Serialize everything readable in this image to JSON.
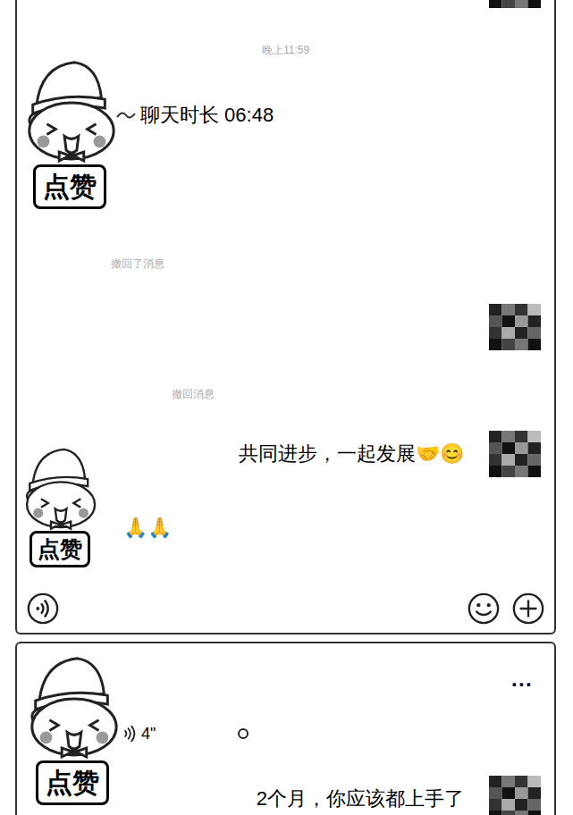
{
  "avatar_label": "点赞",
  "chat": {
    "messages": [
      {
        "kind": "avatar",
        "side": "right"
      },
      {
        "kind": "time",
        "text": "晚上11:59"
      },
      {
        "kind": "call",
        "side": "left",
        "text": "聊天时长 06:48"
      },
      {
        "kind": "notice",
        "text": "撤回了消息"
      },
      {
        "kind": "avatar",
        "side": "right"
      },
      {
        "kind": "notice",
        "text": "撤回消息"
      },
      {
        "kind": "text",
        "side": "right",
        "text": "共同进步，一起发展🤝😊"
      },
      {
        "kind": "text",
        "side": "left",
        "text": "🙏🙏"
      }
    ]
  },
  "second_chat": {
    "menu": "···",
    "messages": [
      {
        "kind": "voice",
        "side": "left",
        "duration": "4\"",
        "unread": true
      },
      {
        "kind": "text",
        "side": "right",
        "text": "2个月，你应该都上手了"
      }
    ]
  }
}
